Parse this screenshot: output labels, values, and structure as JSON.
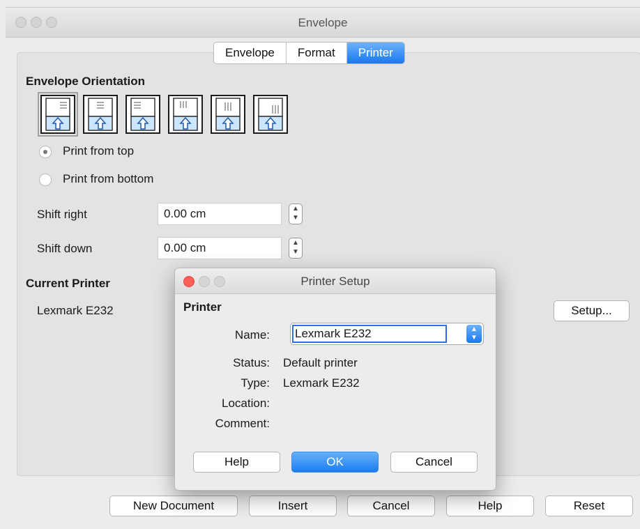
{
  "window": {
    "title": "Envelope",
    "tabs": [
      {
        "label": "Envelope",
        "active": false
      },
      {
        "label": "Format",
        "active": false
      },
      {
        "label": "Printer",
        "active": true
      }
    ]
  },
  "orientation": {
    "heading": "Envelope Orientation",
    "options": [
      "portrait-top-left",
      "portrait-top-center",
      "portrait-top-right",
      "landscape-left",
      "landscape-center",
      "landscape-right"
    ],
    "selected_index": 0,
    "print_from_top": "Print from top",
    "print_from_bottom": "Print from bottom",
    "selected_radio": "top"
  },
  "shift": {
    "right_label": "Shift right",
    "right_value": "0.00 cm",
    "down_label": "Shift down",
    "down_value": "0.00 cm"
  },
  "current_printer": {
    "heading": "Current Printer",
    "name": "Lexmark E232",
    "setup_label": "Setup..."
  },
  "footer": {
    "new_document": "New Document",
    "insert": "Insert",
    "cancel": "Cancel",
    "help": "Help",
    "reset": "Reset"
  },
  "dialog": {
    "title": "Printer Setup",
    "section": "Printer",
    "name_label": "Name:",
    "name_value": "Lexmark E232",
    "status_label": "Status:",
    "status_value": "Default printer",
    "type_label": "Type:",
    "type_value": "Lexmark E232",
    "location_label": "Location:",
    "location_value": "",
    "comment_label": "Comment:",
    "comment_value": "",
    "help": "Help",
    "ok": "OK",
    "cancel": "Cancel",
    "colors": {
      "close": "#fc5f57",
      "inactive": "#d6d6d6"
    }
  }
}
